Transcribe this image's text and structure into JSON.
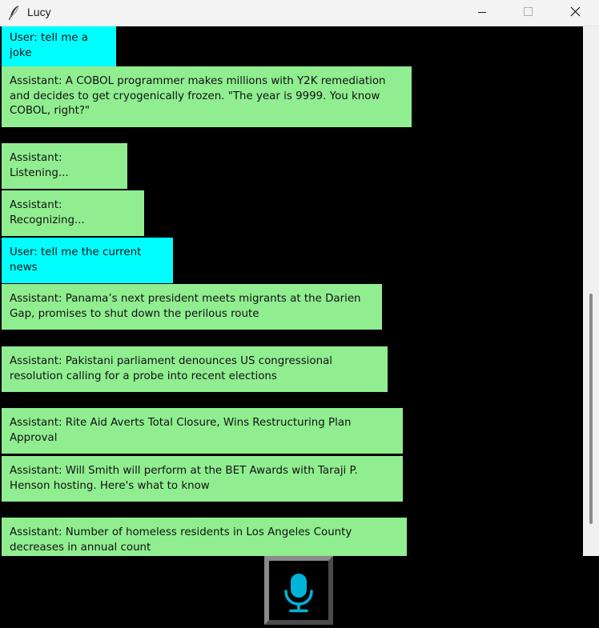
{
  "window": {
    "title": "Lucy",
    "app_icon": "feather-icon"
  },
  "controls": {
    "minimize_icon": "minimize-icon",
    "maximize_icon": "maximize-icon",
    "close_icon": "close-icon"
  },
  "colors": {
    "user_bubble": "#00ffff",
    "assistant_bubble": "#90ee90",
    "background": "#000000",
    "mic_accent": "#00b4d8"
  },
  "messages": [
    {
      "role": "user",
      "text": "User: tell me a joke"
    },
    {
      "role": "assistant",
      "text": "Assistant: A COBOL programmer makes millions with Y2K remediation and decides to get cryogenically frozen. \"The year is 9999. You know COBOL, right?\""
    },
    {
      "role": "assistant",
      "text": "Assistant: Listening..."
    },
    {
      "role": "assistant",
      "text": "Assistant: Recognizing..."
    },
    {
      "role": "user",
      "text": "User: tell me the current news"
    },
    {
      "role": "assistant",
      "text": "Assistant: Panama’s next president meets migrants at the Darien Gap, promises to shut down the perilous route"
    },
    {
      "role": "assistant",
      "text": "Assistant: Pakistani parliament denounces US congressional resolution calling for a probe into recent elections"
    },
    {
      "role": "assistant",
      "text": "Assistant: Rite Aid Averts Total Closure, Wins Restructuring Plan Approval"
    },
    {
      "role": "assistant",
      "text": "Assistant: Will Smith will perform at the BET Awards with Taraji P. Henson hosting. Here's what to know"
    },
    {
      "role": "assistant",
      "text": "Assistant: Number of homeless residents in Los Angeles County decreases in annual count"
    }
  ],
  "mic_button": {
    "icon": "microphone-icon"
  }
}
